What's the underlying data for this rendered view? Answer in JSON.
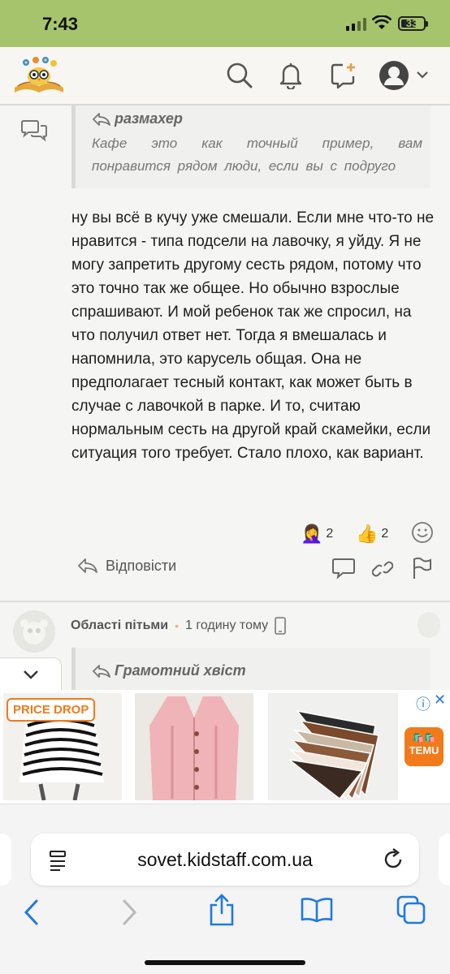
{
  "status_bar": {
    "time": "7:43",
    "battery": "33"
  },
  "header": {
    "logo_icon": "owl-book-logo",
    "icons": [
      "search-icon",
      "bell-icon",
      "new-post-icon",
      "avatar-icon",
      "chevron-down-icon"
    ]
  },
  "post": {
    "quote": {
      "author": "размахер",
      "text_line1": "Кафе это как точный пример, вам",
      "text_line2": "понравится рядом люди, если вы с подруго"
    },
    "body": "ну вы всё в кучу уже смешали. Если мне что-то не нравится - типа подсели на лавочку, я уйду. Я не могу запретить другому сесть рядом, потому что это точно так же общее. Но обычно взрослые спрашивают. И мой ребенок так же спросил, на что получил ответ нет. Тогда я вмешалась и напомнила, это карусель общая. Она не предполагает тесный контакт, как может быть в случае с лавочкой в парке. И то, считаю нормальным сесть на другой край скамейки, если ситуация того требует. Стало плохо, как вариант.",
    "reactions": [
      {
        "emoji": "🤦‍♀️",
        "count": "2"
      },
      {
        "emoji": "👍",
        "count": "2"
      }
    ],
    "reply_label": "Відповісти"
  },
  "next_post": {
    "author": "Області пітьми",
    "time": "1 годину тому",
    "quote_author": "Грамотний хвіст"
  },
  "ad": {
    "badge": "PRICE DROP",
    "brand": "TEMU",
    "brand_sub": "🛍️🛍️",
    "info_icon": "ⓘ",
    "close": "✕"
  },
  "browser": {
    "url": "sovet.kidstaff.com.ua"
  }
}
